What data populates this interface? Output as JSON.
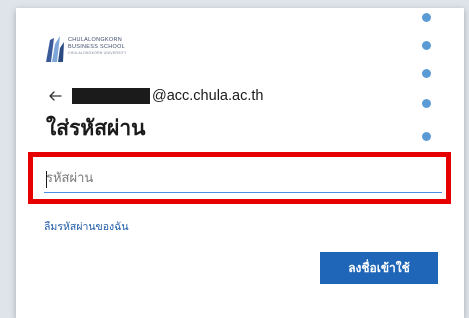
{
  "logo": {
    "name": "CHULALONGKORN\nBUSINESS SCHOOL",
    "subtitle": "CHULALONGKORN UNIVERSITY",
    "icon": "chula-pillar-logo"
  },
  "identity": {
    "email_suffix": "@acc.chula.ac.th",
    "back_icon": "arrow-left-icon"
  },
  "heading": "ใส่รหัสผ่าน",
  "password": {
    "value": "",
    "placeholder": "รหัสผ่าน"
  },
  "forgot_link": "ลืมรหัสผ่านของฉัน",
  "signin_button": "ลงชื่อเข้าใช้",
  "colors": {
    "accent": "#1f66b8",
    "link": "#1f5ba6",
    "highlight": "#e60000",
    "dots": "#5b9bd5"
  }
}
